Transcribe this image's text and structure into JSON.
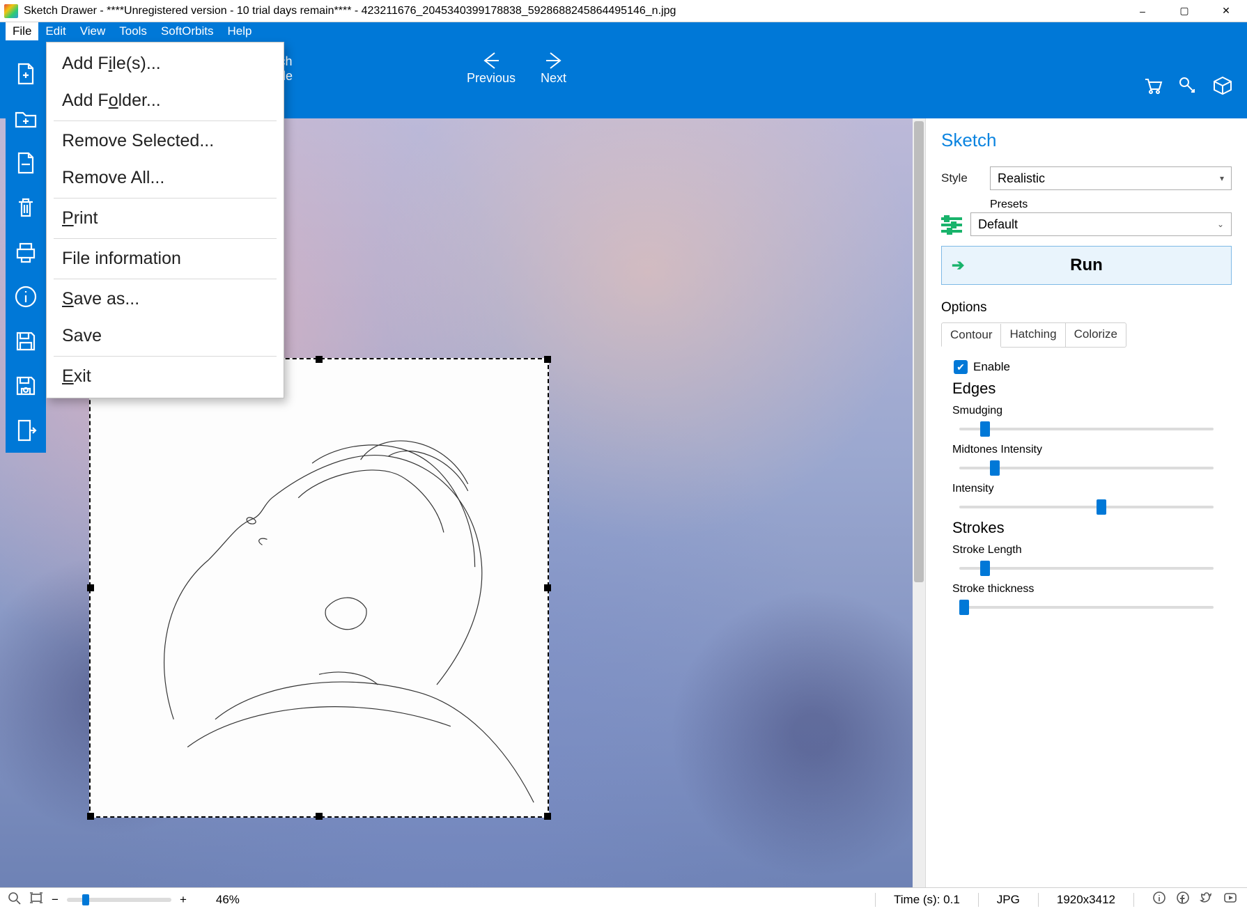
{
  "title": "Sketch Drawer - ****Unregistered version - 10 trial days remain**** - 423211676_2045340399178838_5928688245864495146_n.jpg",
  "menubar": [
    "File",
    "Edit",
    "View",
    "Tools",
    "SoftOrbits",
    "Help"
  ],
  "file_menu": {
    "add_files": "Add File(s)...",
    "add_folder": "Add Folder...",
    "remove_selected": "Remove Selected...",
    "remove_all": "Remove All...",
    "print": "Print",
    "file_info": "File information",
    "save_as": "Save as...",
    "save": "Save",
    "exit": "Exit"
  },
  "toolbar": {
    "mode_top": "ch",
    "mode_bottom": "de",
    "previous": "Previous",
    "next": "Next"
  },
  "right": {
    "heading": "Sketch",
    "style_label": "Style",
    "style_value": "Realistic",
    "presets_label": "Presets",
    "presets_value": "Default",
    "run": "Run",
    "options": "Options",
    "tabs": {
      "contour": "Contour",
      "hatching": "Hatching",
      "colorize": "Colorize"
    },
    "enable": "Enable",
    "edges": "Edges",
    "smudging": "Smudging",
    "midtones": "Midtones Intensity",
    "intensity": "Intensity",
    "strokes": "Strokes",
    "stroke_len": "Stroke Length",
    "stroke_thick": "Stroke thickness"
  },
  "sliders": {
    "smudging_pct": 10,
    "midtones_pct": 14,
    "intensity_pct": 56,
    "stroke_len_pct": 10,
    "stroke_thick_pct": 2
  },
  "status": {
    "zoom_pct": "46%",
    "time": "Time (s): 0.1",
    "format": "JPG",
    "dims": "1920x3412"
  }
}
